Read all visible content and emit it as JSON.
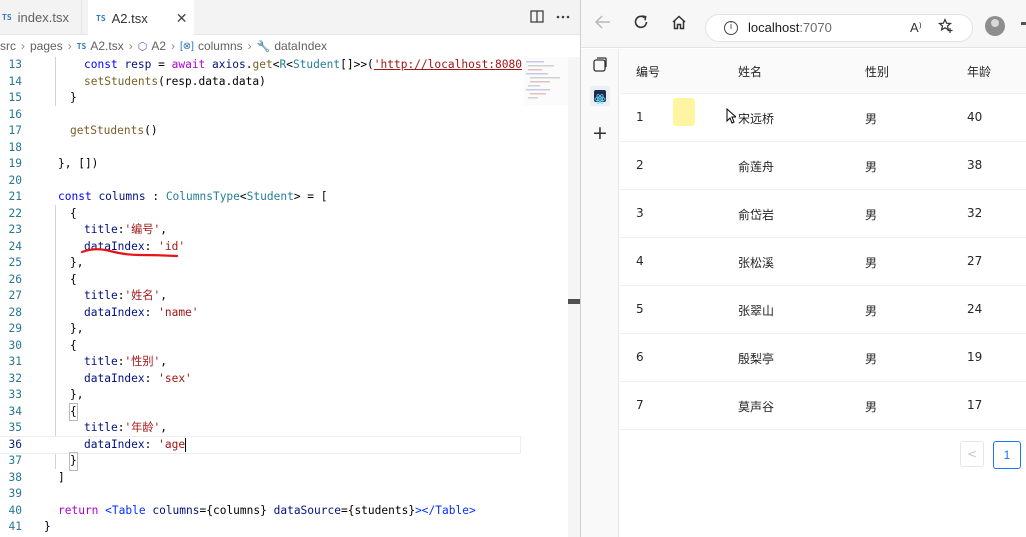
{
  "editor": {
    "tabs": [
      {
        "badge": "TS",
        "label": "index.tsx"
      },
      {
        "badge": "TS",
        "label": "A2.tsx",
        "close": "✕"
      }
    ],
    "breadcrumb": {
      "src": "src",
      "pages": "pages",
      "file_badge": "TS",
      "file": "A2.tsx",
      "component": "A2",
      "variable": "columns",
      "property": "dataIndex"
    },
    "line_numbers": [
      "13",
      "14",
      "15",
      "16",
      "17",
      "18",
      "19",
      "20",
      "21",
      "22",
      "23",
      "24",
      "25",
      "26",
      "27",
      "28",
      "29",
      "30",
      "31",
      "32",
      "33",
      "34",
      "35",
      "36",
      "37",
      "38",
      "39",
      "40",
      "41"
    ],
    "code": {
      "l13": {
        "const": "const",
        "resp": "resp",
        "eq": " = ",
        "await": "await",
        "axios": "axios",
        "get": "get",
        "lt": "<",
        "R": "R",
        "lt2": "<",
        "Student": "Student",
        "arr": "[]>>(",
        "url": "'http://localhost:8080"
      },
      "l14": {
        "fn": "setStudents",
        "args": "(resp.data.data)"
      },
      "l15": "}",
      "l17": {
        "fn": "getStudents",
        "args": "()"
      },
      "l19": "}, [])",
      "l21": {
        "const": "const",
        "name": "columns",
        "colon": " : ",
        "type": "ColumnsType",
        "lt": "<",
        "gen": "Student",
        "rest": "> = ["
      },
      "open": "{",
      "close": "},",
      "close_last": "}",
      "title_key": "title",
      "dataIndex_key": "dataIndex",
      "colon": ":",
      "colon_sp": ": ",
      "comma": ",",
      "titles": [
        "'编号'",
        "'姓名'",
        "'性别'",
        "'年龄'"
      ],
      "indexes": [
        "'id'",
        "'name'",
        "'sex'",
        "'age"
      ],
      "l38": "]",
      "l40": {
        "return": "return",
        "tag1": "<Table",
        "attr1": "columns",
        "val1": "={columns}",
        "attr2": "dataSource",
        "val2": "={students}",
        "tag2": "></Table>"
      },
      "l41": "}"
    }
  },
  "browser": {
    "url_host": "localhost",
    "url_port": ":7070",
    "read_aloud": "A⁾",
    "table": {
      "headers": [
        "编号",
        "姓名",
        "性别",
        "年龄"
      ],
      "rows": [
        [
          "1",
          "宋远桥",
          "男",
          "40"
        ],
        [
          "2",
          "俞莲舟",
          "男",
          "38"
        ],
        [
          "3",
          "俞岱岩",
          "男",
          "32"
        ],
        [
          "4",
          "张松溪",
          "男",
          "27"
        ],
        [
          "5",
          "张翠山",
          "男",
          "24"
        ],
        [
          "6",
          "殷梨亭",
          "男",
          "19"
        ],
        [
          "7",
          "莫声谷",
          "男",
          "17"
        ]
      ]
    },
    "pagination": {
      "prev": "<",
      "current": "1"
    }
  },
  "colors": {
    "accent": "#1677ff",
    "underline": "#e8141b",
    "keyword": "#0000ff",
    "string": "#a31515"
  }
}
